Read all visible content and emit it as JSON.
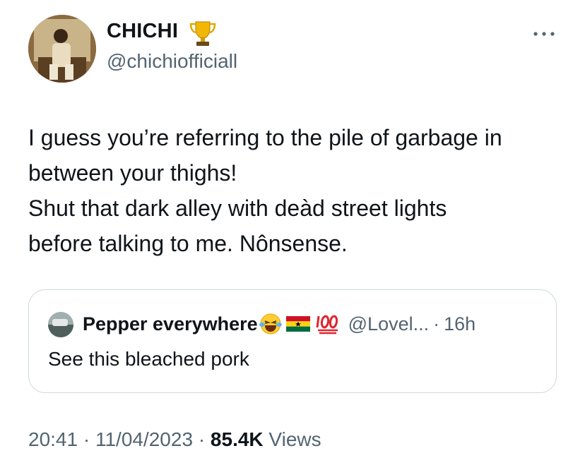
{
  "author": {
    "display_name": "CHICHI",
    "handle": "@chichiofficiall",
    "badge_icon": "trophy-icon"
  },
  "tweet": {
    "lines": [
      "I guess you’re referring to the pile of garbage in",
      "between your thighs!",
      "Shut that dark alley with deàd street lights",
      "before talking to me. Nônsense."
    ]
  },
  "quote": {
    "name": "Pepper everywhere",
    "handle": "@Lovel...",
    "separator": "·",
    "time": "16h",
    "text": "See this bleached pork",
    "name_emojis": [
      "laughing-tears-icon",
      "ghana-flag-icon",
      "hundred-points-icon"
    ]
  },
  "meta": {
    "time": "20:41",
    "sep1": "·",
    "date": "11/04/2023",
    "sep2": "·",
    "views_count": "85.4K",
    "views_label": "Views"
  },
  "colors": {
    "text_primary": "#0f1419",
    "text_secondary": "#536471",
    "border": "#cfd9de"
  }
}
